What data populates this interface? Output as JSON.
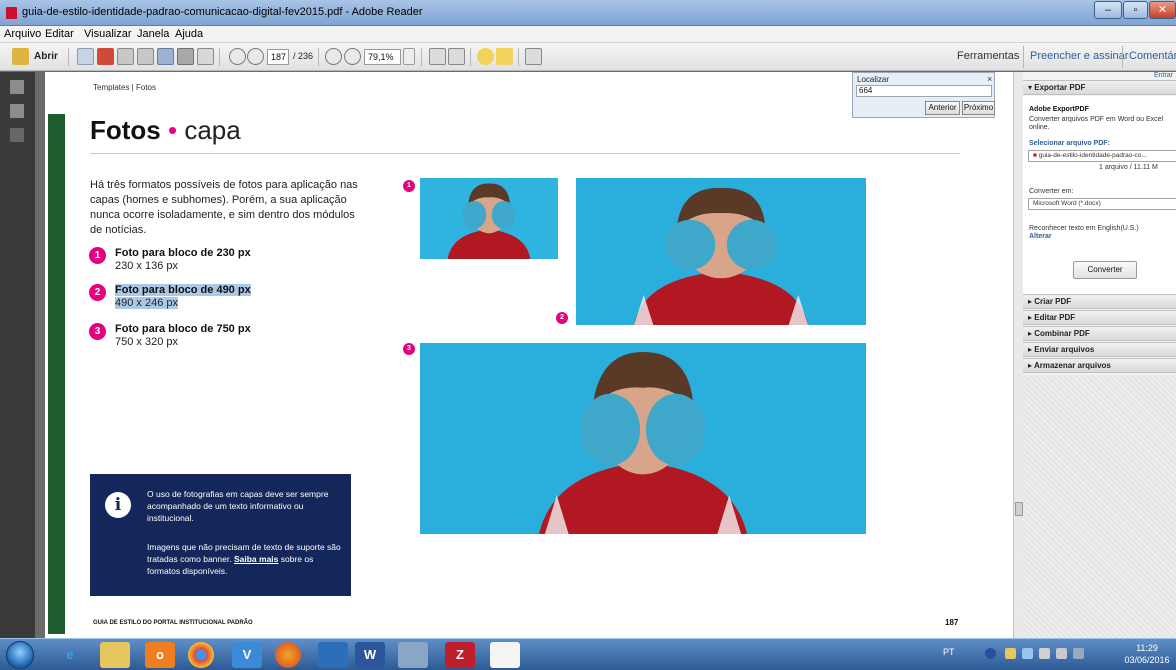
{
  "window": {
    "title": "guia-de-estilo-identidade-padrao-comunicacao-digital-fev2015.pdf - Adobe Reader"
  },
  "menu": [
    "Arquivo",
    "Editar",
    "Visualizar",
    "Janela",
    "Ajuda"
  ],
  "toolbar": {
    "open_label": "Abrir",
    "current_page": "187",
    "total_pages": "/ 236",
    "zoom": "79,1%",
    "tools": "Ferramentas",
    "fill_sign": "Preencher e assinar",
    "comments": "Comentário"
  },
  "find": {
    "label": "Localizar",
    "close": "×",
    "value": "664",
    "prev": "Anterior",
    "next": "Próximo"
  },
  "page": {
    "breadcrumb": "Templates | Fotos",
    "title_bold": "Fotos",
    "title_sep": "•",
    "title_light": "capa",
    "intro": "Há três formatos possíveis de fotos para aplicação nas capas (homes e subhomes). Porém, a sua aplicação nunca ocorre isoladamente, e sim dentro dos módulos de notícias.",
    "options": [
      {
        "num": "1",
        "label": "Foto para bloco de 230 px",
        "size": "230 x 136 px"
      },
      {
        "num": "2",
        "label": "Foto para bloco de 490 px",
        "size": "490 x 246 px"
      },
      {
        "num": "3",
        "label": "Foto para bloco de 750 px",
        "size": "750 x 320 px"
      }
    ],
    "info": {
      "icon": "i",
      "p1": "O uso de fotografias em capas deve ser sempre acompanhado de um texto informativo ou institucional.",
      "p2": "Imagens que não precisam de texto de suporte são tratadas como banner.",
      "link": "Saiba mais",
      "p2_end": " sobre os formatos disponíveis."
    },
    "footer_left": "GUIA DE ESTILO DO PORTAL INSTITUCIONAL PADRÃO",
    "footer_page": "187",
    "photo_badges": [
      "1",
      "2",
      "3"
    ]
  },
  "right_panel": {
    "signin": "Entrar",
    "export_header": "Exportar PDF",
    "export_title": "Adobe ExportPDF",
    "export_desc1": "Converter arquivos PDF em Word ou Excel",
    "export_desc2": "online.",
    "select_label": "Selecionar arquivo PDF:",
    "selected_file": "guia-de-estilo-identidade-padrao-co...",
    "file_count": "1 arquivo / 11.11 M",
    "convert_to_label": "Converter em:",
    "convert_to": "Microsoft Word (*.docx)",
    "ocr_label": "Reconhecer texto em English(U.S.)",
    "ocr_change": "Alterar",
    "convert_button": "Converter",
    "sections": [
      "Criar PDF",
      "Editar PDF",
      "Combinar PDF",
      "Enviar arquivos",
      "Armazenar arquivos"
    ]
  },
  "taskbar": {
    "lang": "PT",
    "clock_time": "11:29",
    "clock_date": "03/06/2016"
  }
}
